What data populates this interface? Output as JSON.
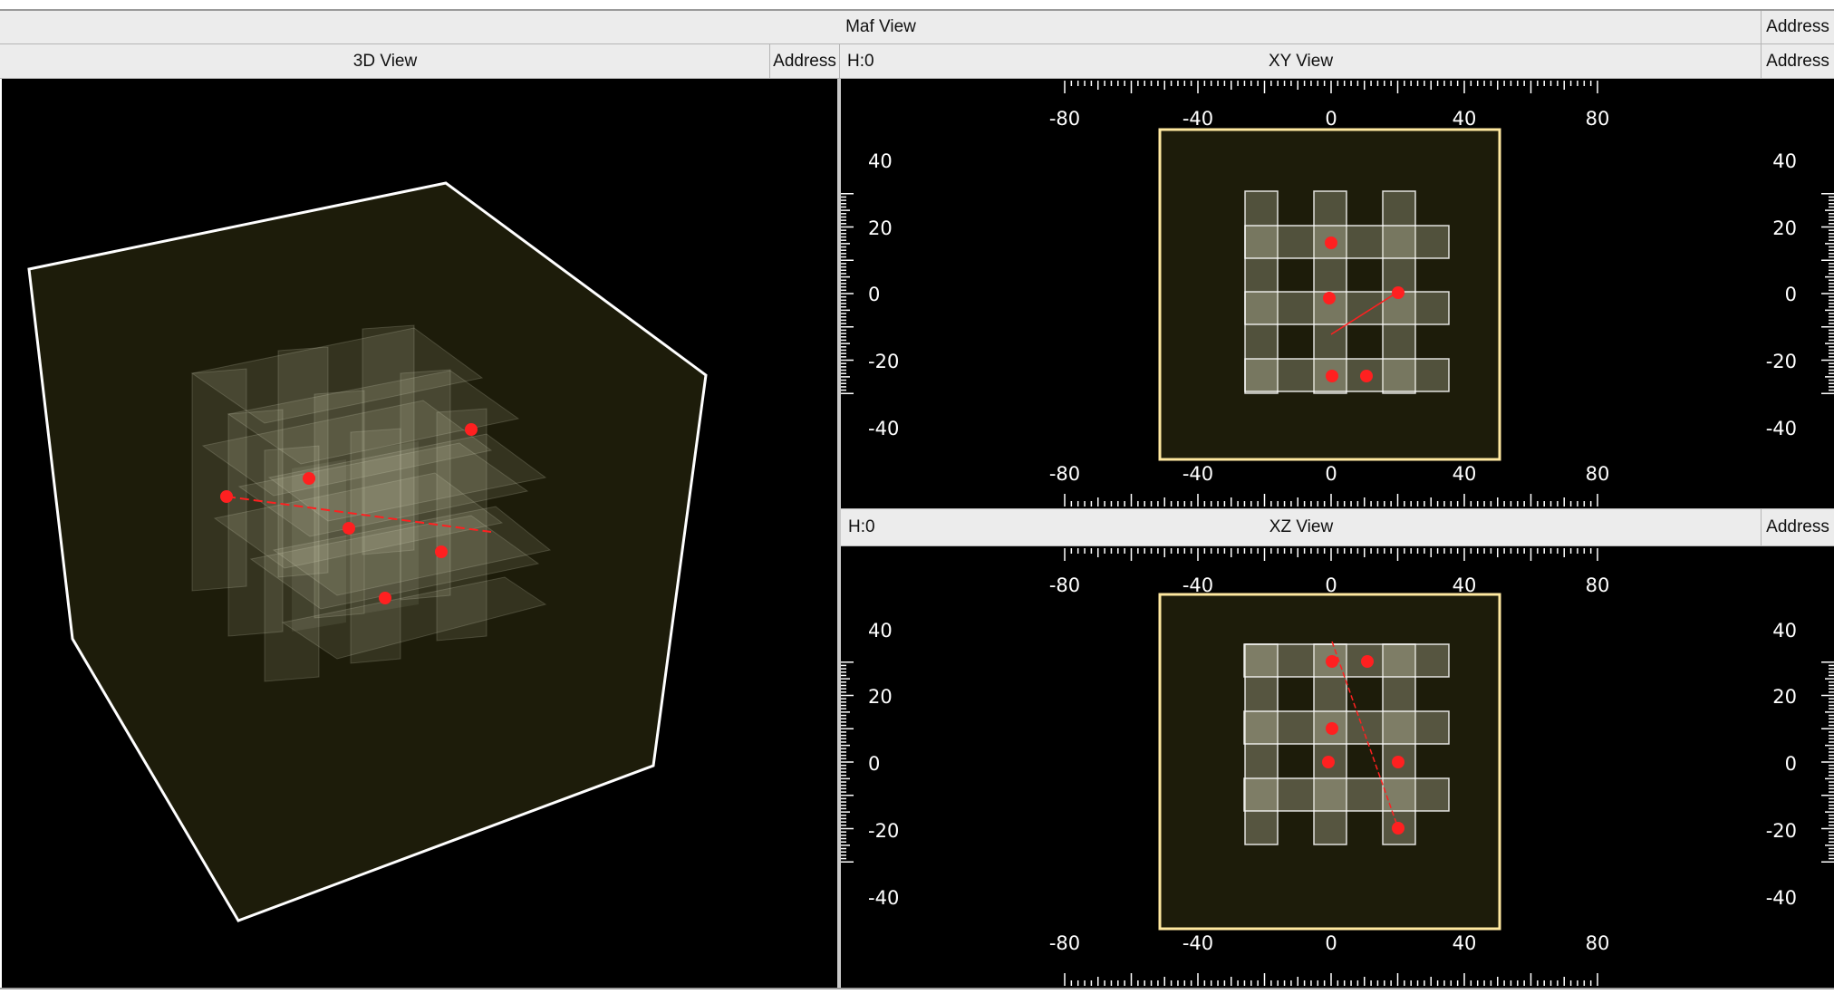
{
  "window": {
    "title": "Maf View",
    "address_label": "Address"
  },
  "view3d": {
    "title": "3D View",
    "address_label": "Address"
  },
  "xy_view": {
    "title": "XY View",
    "hlabel": "H:0",
    "address_label": "Address",
    "x_ticks": [
      "-80",
      "-40",
      "0",
      "40",
      "80"
    ],
    "y_ticks": [
      "40",
      "20",
      "0",
      "-20",
      "-40"
    ]
  },
  "xz_view": {
    "title": "XZ View",
    "hlabel": "H:0",
    "address_label": "Address",
    "x_ticks": [
      "-80",
      "-40",
      "0",
      "40",
      "80"
    ],
    "y_ticks": [
      "40",
      "20",
      "0",
      "-20",
      "-40"
    ]
  },
  "colors": {
    "frame_border": "#ffe9a0",
    "hit_point": "#ff2020",
    "track_line": "#ff2020",
    "background": "#000000"
  }
}
